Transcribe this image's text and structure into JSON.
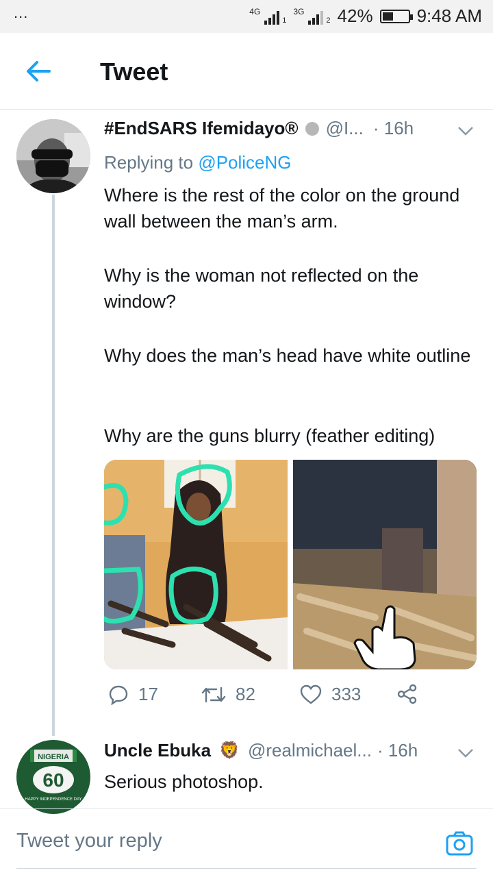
{
  "status_bar": {
    "menu_dots": "...",
    "net1": "4G",
    "sim1": "1",
    "net2": "3G",
    "sim2": "2",
    "battery": "42%",
    "battery_level": 0.42,
    "time": "9:48 AM"
  },
  "header": {
    "title": "Tweet",
    "back_icon": "arrow-left-icon"
  },
  "tweet": {
    "name": "#EndSARS Ifemidayo®",
    "handle": "@I...",
    "time": "· 16h",
    "replying_prefix": "Replying to",
    "replying_to": "@PoliceNG",
    "paragraphs": [
      "Where is the rest of the color on the ground wall between the man’s arm.",
      "Why is the woman not reflected on the window?",
      "Why does the man’s head have white outline",
      "Why are the guns blurry (feather editing)"
    ],
    "actions": {
      "replies": "17",
      "retweets": "82",
      "likes": "333"
    }
  },
  "reply": {
    "name": "Uncle Ebuka",
    "badge": "🦁",
    "handle": "@realmichael...",
    "time": "· 16h",
    "text": "Serious photoshop.",
    "avatar_banner": "NIGERIA",
    "avatar_number": "60",
    "avatar_caption": "HAPPY INDEPENDENCE DAY"
  },
  "compose": {
    "placeholder": "Tweet your reply",
    "camera_icon": "camera-icon"
  },
  "colors": {
    "accent": "#1da1f2",
    "secondary_text": "#657786",
    "highlight": "#2de0b0"
  }
}
